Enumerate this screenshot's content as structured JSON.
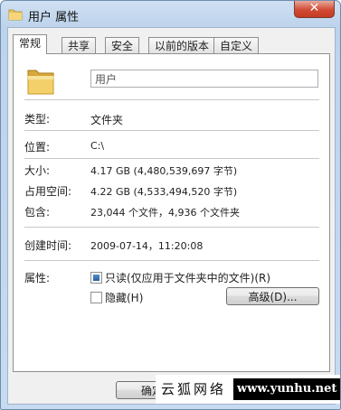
{
  "window": {
    "title": "用户 属性",
    "close_glyph": "✕"
  },
  "tabs": [
    {
      "label": "常规",
      "active": true
    },
    {
      "label": "共享",
      "active": false
    },
    {
      "label": "安全",
      "active": false
    },
    {
      "label": "以前的版本",
      "active": false
    },
    {
      "label": "自定义",
      "active": false
    }
  ],
  "general": {
    "name_value": "用户",
    "rows": {
      "type": {
        "label": "类型:",
        "value": "文件夹"
      },
      "location": {
        "label": "位置:",
        "value": "C:\\"
      },
      "size": {
        "label": "大小:",
        "value": "4.17 GB (4,480,539,697 字节)"
      },
      "size_on_disk": {
        "label": "占用空间:",
        "value": "4.22 GB (4,533,494,520 字节)"
      },
      "contains": {
        "label": "包含:",
        "value": "23,044 个文件，4,936 个文件夹"
      },
      "created": {
        "label": "创建时间:",
        "value": "2009-07-14，11:20:08"
      }
    },
    "attributes": {
      "label": "属性:",
      "readonly_label": "只读(仅应用于文件夹中的文件)(R)",
      "readonly_state": "indeterminate",
      "hidden_label": "隐藏(H)",
      "hidden_state": "unchecked",
      "advanced_button": "高级(D)..."
    }
  },
  "footer": {
    "ok_button": "确定"
  },
  "watermark": {
    "text": "云狐网络",
    "url": "www.yunhu.net"
  },
  "icons": {
    "title_icon": "folder-icon",
    "large_icon": "folder-icon"
  }
}
